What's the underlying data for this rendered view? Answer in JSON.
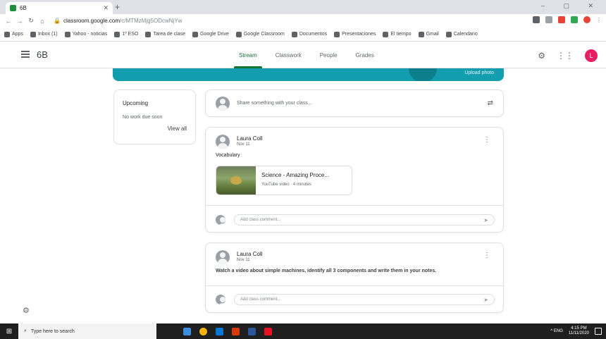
{
  "browser": {
    "tab_title": "6B",
    "url_host": "classroom.google.com",
    "url_path": "/c/MTMzMjg5ODcwNjYw",
    "window_controls": "– ▢ ✕",
    "bookmarks": [
      "Apps",
      "Inbox (1)",
      "Yahoo - noticias",
      "1º ESO",
      "Tarea de clase",
      "Google Drive",
      "Google Classroom",
      "Documentos",
      "Presentaciones",
      "El tiempo",
      "Gmail",
      "Calendario"
    ]
  },
  "classroom": {
    "class_name": "6B",
    "tabs": [
      "Stream",
      "Classwork",
      "People",
      "Grades"
    ],
    "active_tab": "Stream",
    "avatar_letter": "L",
    "banner_action": "Upload photo",
    "upcoming": {
      "heading": "Upcoming",
      "empty_text": "No work due soon",
      "view_all": "View all"
    },
    "share_placeholder": "Share something with your class...",
    "posts": [
      {
        "author": "Laura Coll",
        "date": "Nov 11",
        "text": "Vocabulary",
        "attachment_title": "Science - Amazing Proce...",
        "attachment_source": "YouTube video · 4 minutes",
        "comment_placeholder": "Add class comment..."
      },
      {
        "author": "Laura Coll",
        "date": "Nov 11",
        "text": "Watch a video about simple machines, identify all 3 components and write them in your notes.",
        "comment_placeholder": "Add class comment..."
      }
    ]
  },
  "taskbar": {
    "search_placeholder": "Type here to search",
    "time": "4:15 PM",
    "date": "11/11/2020",
    "tray_text": "^ ENG"
  },
  "colors": {
    "banner": "#129eaf",
    "active_tab": "#137333",
    "avatar": "#e91e63"
  }
}
